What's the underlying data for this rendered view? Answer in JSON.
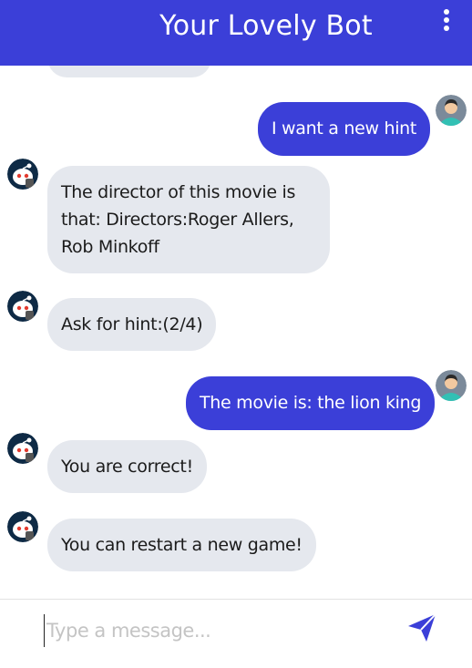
{
  "header": {
    "title": "Your Lovely Bot",
    "menu_icon": "kebab-menu-icon"
  },
  "messages": [
    {
      "sender": "bot",
      "text": ""
    },
    {
      "sender": "user",
      "text": "I want a new hint"
    },
    {
      "sender": "bot",
      "lines": [
        "The director of this movie is",
        "that: Directors:Roger Allers,",
        "Rob Minkoff"
      ]
    },
    {
      "sender": "bot",
      "text": "Ask for hint:(2/4)"
    },
    {
      "sender": "user",
      "text": "The movie is: the lion king"
    },
    {
      "sender": "bot",
      "text": "You are correct!"
    },
    {
      "sender": "bot",
      "text": "You can restart a new game!"
    }
  ],
  "composer": {
    "placeholder": "Type a message...",
    "value": "",
    "send_icon": "paper-plane-send-icon"
  },
  "avatars": {
    "bot_icon": "reddit-bot-avatar-icon",
    "user_icon": "user-avatar-icon"
  },
  "colors": {
    "accent": "#3b3fd8",
    "bot_bubble": "#e5e8ee",
    "user_text": "#ffffff",
    "bot_text": "#1b1b1b"
  }
}
